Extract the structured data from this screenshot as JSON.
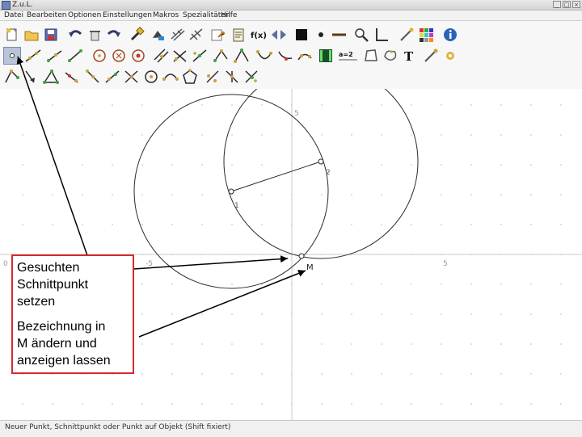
{
  "window": {
    "title": "Z.u.L."
  },
  "menu": {
    "items": [
      "Datei",
      "Bearbeiten",
      "Optionen",
      "Einstellungen",
      "Makros",
      "Spezialitäten",
      "Hilfe"
    ]
  },
  "toolbar": {
    "row1": [
      "new-file-icon",
      "open-file-icon",
      "save-file-icon",
      "undo-icon",
      "delete-icon",
      "redo-icon",
      "hammer-icon",
      "paint-icon",
      "grid-icon",
      "lines-icon",
      "text-doc-icon",
      "clipboard-icon",
      "function-icon",
      "arrows-icon",
      "black-square-icon",
      "dot-icon",
      "dash-icon",
      "zoom-icon",
      "axis-icon",
      "wand-icon",
      "color-grid-icon",
      "info-icon"
    ],
    "function_label": "f(x)",
    "text_tool_label": "T",
    "equals_label": "a=2",
    "row2": [
      "point-tool-icon",
      "line-icon",
      "ray-icon",
      "segment-icon",
      "circle-icon",
      "circle-radius-icon",
      "circle-fixed-icon",
      "parallel-icon",
      "perpendicular-icon",
      "midpoint-icon",
      "angle-icon",
      "triangle-points-icon",
      "arc-icon",
      "conic-icon",
      "bisector-icon",
      "animation-icon",
      "expression-icon",
      "polygon-icon",
      "curve-icon",
      "text-tool-icon",
      "hide-icon",
      "pen-icon"
    ],
    "row3": [
      "move-icon",
      "vector-icon",
      "triangle-icon",
      "circle-compass-icon",
      "mirror-icon",
      "rotate-icon",
      "quadrilateral-icon",
      "ring-icon",
      "locus-icon",
      "pentagon-icon",
      "fixed-segment-icon",
      "tangent-icon",
      "angle-bisector-icon"
    ]
  },
  "canvas": {
    "axis_labels": {
      "x_neg": "-5",
      "x_pos": "5",
      "y_pos": "5",
      "left_edge": "0"
    },
    "point_labels": {
      "p1": "1",
      "p2": "2",
      "intersection": "M"
    }
  },
  "annotation": {
    "line1": "Gesuchten",
    "line2": "Schnittpunkt",
    "line3": "setzen",
    "line4": "Bezeichnung in",
    "line5": "M ändern und",
    "line6": "anzeigen lassen"
  },
  "status": {
    "text": "Neuer Punkt, Schnittpunkt oder Punkt auf Objekt (Shift fixiert)"
  },
  "colors": {
    "callout_border": "#d62a2a",
    "arrow": "#000000",
    "grid_dot": "#c8c8c8"
  }
}
